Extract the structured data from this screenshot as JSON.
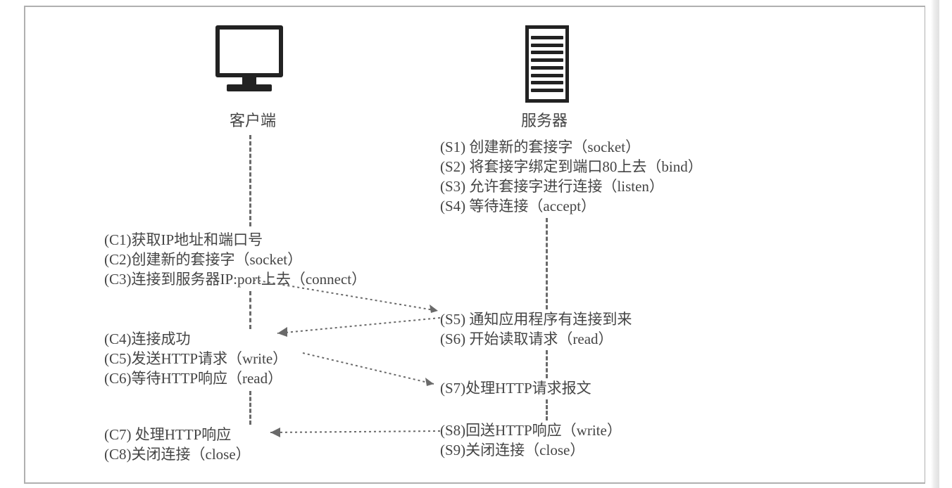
{
  "client": {
    "title": "客户端",
    "steps": {
      "c1": "(C1)获取IP地址和端口号",
      "c2": "(C2)创建新的套接字（socket）",
      "c3": "(C3)连接到服务器IP:port上去（connect）",
      "c4": "(C4)连接成功",
      "c5": "(C5)发送HTTP请求（write）",
      "c6": "(C6)等待HTTP响应（read）",
      "c7": "(C7) 处理HTTP响应",
      "c8": "(C8)关闭连接（close）"
    }
  },
  "server": {
    "title": "服务器",
    "steps": {
      "s1": "(S1)  创建新的套接字（socket）",
      "s2": "(S2)  将套接字绑定到端口80上去（bind）",
      "s3": "(S3)  允许套接字进行连接（listen）",
      "s4": "(S4)  等待连接（accept）",
      "s5": "(S5)  通知应用程序有连接到来",
      "s6": "(S6)  开始读取请求（read）",
      "s7": "(S7)处理HTTP请求报文",
      "s8": "(S8)回送HTTP响应（write）",
      "s9": "(S9)关闭连接（close）"
    }
  }
}
